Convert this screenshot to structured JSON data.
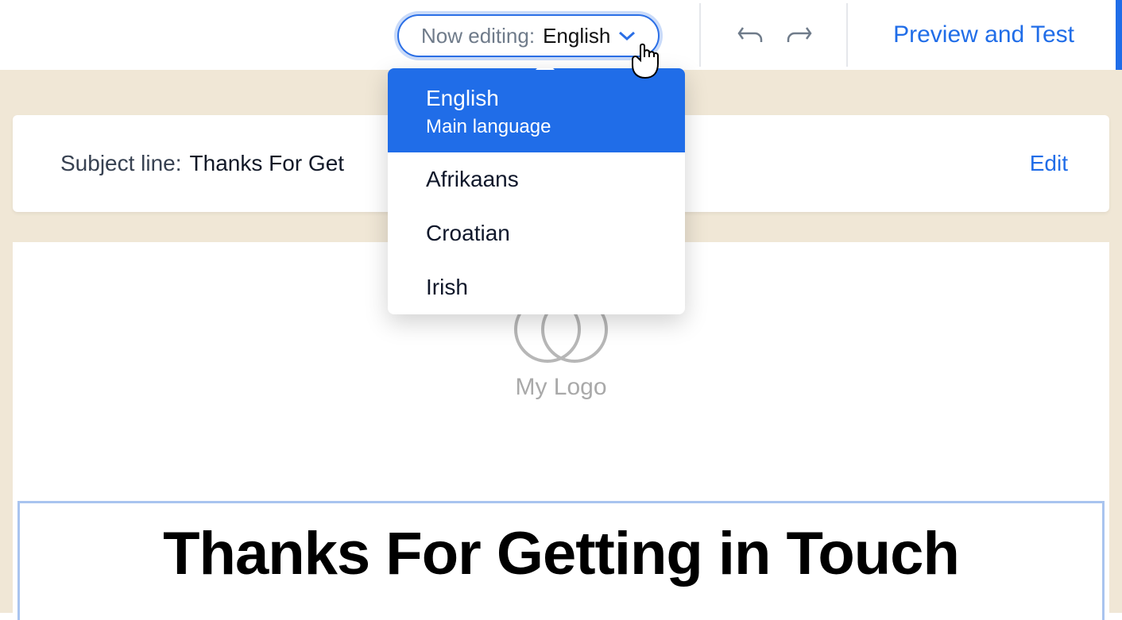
{
  "toolbar": {
    "language_selector": {
      "prefix": "Now editing:",
      "current": "English"
    },
    "preview_label": "Preview and Test"
  },
  "dropdown": {
    "items": [
      {
        "label": "English",
        "sub": "Main language",
        "selected": true
      },
      {
        "label": "Afrikaans",
        "selected": false
      },
      {
        "label": "Croatian",
        "selected": false
      },
      {
        "label": "Irish",
        "selected": false
      }
    ]
  },
  "subject": {
    "label": "Subject line:",
    "value": "Thanks For Get",
    "edit_label": "Edit"
  },
  "logo": {
    "text": "My Logo"
  },
  "headline": "Thanks For Getting in Touch"
}
